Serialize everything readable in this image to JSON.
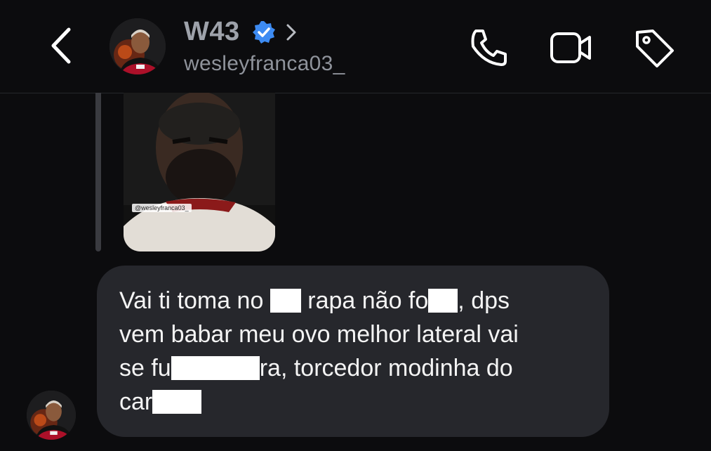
{
  "header": {
    "name": "W43",
    "username": "wesleyfranca03_",
    "verified": true,
    "icons": {
      "back": "chevron-left-icon",
      "verified": "verified-badge-icon",
      "profile": "chevron-right-icon",
      "call": "phone-icon",
      "video": "video-camera-icon",
      "tag": "tag-icon"
    }
  },
  "story_reply": {
    "tag_text": "@wesleyfranca03_"
  },
  "message": {
    "lines": [
      [
        "Vai ti toma no ",
        " rapa não fo",
        ", dps"
      ],
      [
        "vem babar meu ovo melhor lateral vai"
      ],
      [
        "se fu",
        "ra, torcedor modinha do"
      ],
      [
        "car",
        ""
      ]
    ]
  },
  "colors": {
    "background": "#0c0c0e",
    "bubble": "#26272c",
    "verified_blue": "#3d8bf2",
    "name_gray": "#9ea2aa"
  }
}
